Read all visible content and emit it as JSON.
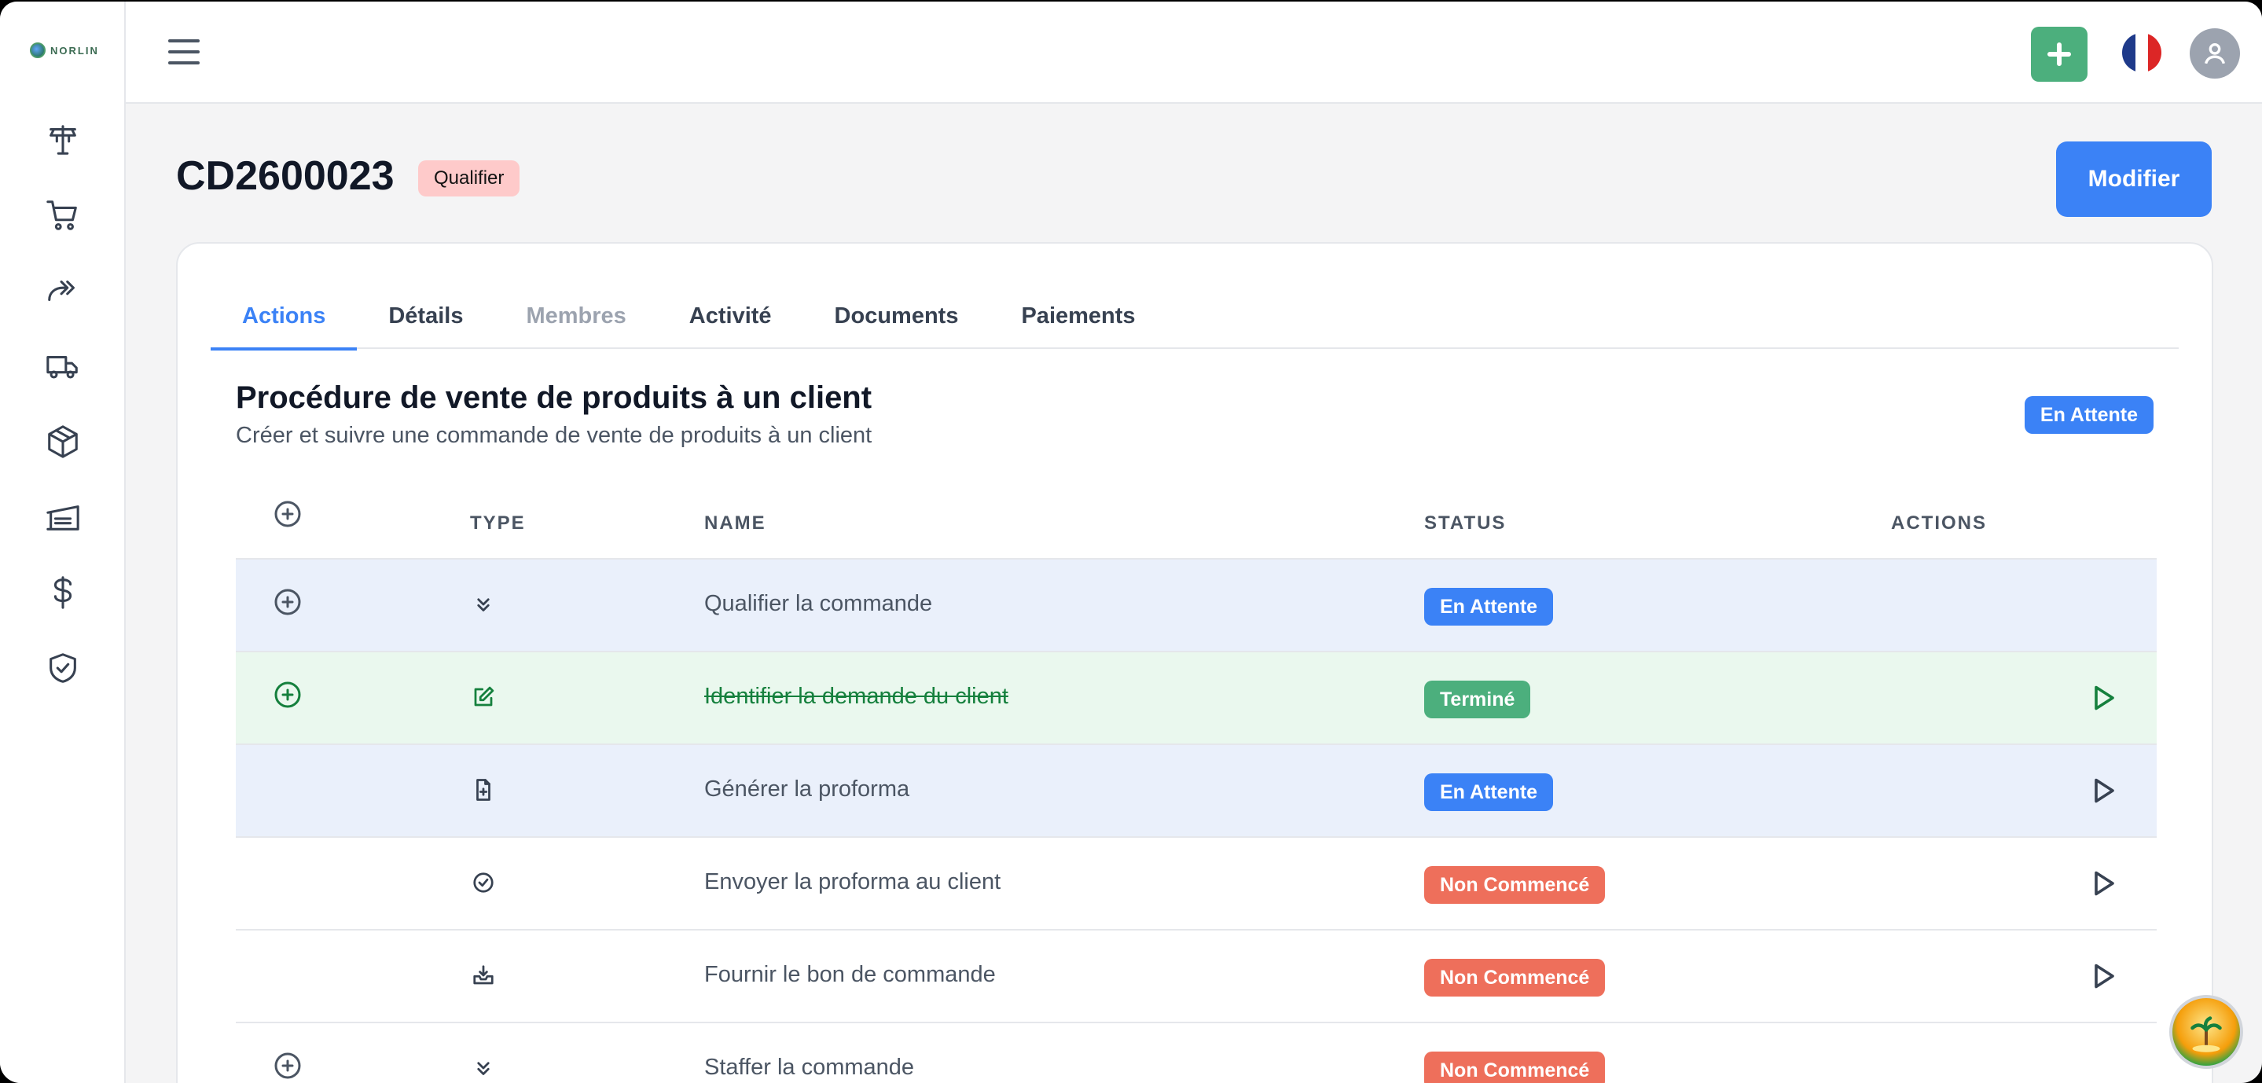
{
  "app": {
    "logo_text": "NORLIN"
  },
  "sidebar": {
    "items": [
      {
        "name": "dashboard"
      },
      {
        "name": "cart"
      },
      {
        "name": "forward"
      },
      {
        "name": "truck"
      },
      {
        "name": "package"
      },
      {
        "name": "warehouse"
      },
      {
        "name": "dollar"
      },
      {
        "name": "shield-check"
      }
    ]
  },
  "header": {
    "title": "CD2600023",
    "badge": "Qualifier",
    "modify_label": "Modifier"
  },
  "tabs": [
    {
      "label": "Actions",
      "state": "active"
    },
    {
      "label": "Détails",
      "state": "normal"
    },
    {
      "label": "Membres",
      "state": "muted"
    },
    {
      "label": "Activité",
      "state": "normal"
    },
    {
      "label": "Documents",
      "state": "normal"
    },
    {
      "label": "Paiements",
      "state": "normal"
    }
  ],
  "procedure": {
    "title": "Procédure de vente de produits à un client",
    "subtitle": "Créer et suivre une commande de vente de produits à un client",
    "status": "En Attente"
  },
  "table": {
    "headers": {
      "type": "TYPE",
      "name": "NAME",
      "status": "STATUS",
      "actions": "ACTIONS"
    },
    "rows": [
      {
        "type_icon": "chevrons-down-icon",
        "name": "Qualifier la commande",
        "status": "En Attente",
        "status_kind": "wait",
        "has_plus": true,
        "has_play": false,
        "tint": "blue"
      },
      {
        "type_icon": "edit-icon",
        "name": "Identifier la demande du client",
        "status": "Terminé",
        "status_kind": "done",
        "has_plus": true,
        "has_play": true,
        "tint": "green"
      },
      {
        "type_icon": "file-plus-icon",
        "name": "Générer la proforma",
        "status": "En Attente",
        "status_kind": "wait",
        "has_plus": false,
        "has_play": true,
        "tint": "blue"
      },
      {
        "type_icon": "check-circle-icon",
        "name": "Envoyer la proforma au client",
        "status": "Non Commencé",
        "status_kind": "none",
        "has_plus": false,
        "has_play": true,
        "tint": "none"
      },
      {
        "type_icon": "inbox-download-icon",
        "name": "Fournir le bon de commande",
        "status": "Non Commencé",
        "status_kind": "none",
        "has_plus": false,
        "has_play": true,
        "tint": "none"
      },
      {
        "type_icon": "chevrons-down-icon",
        "name": "Staffer la commande",
        "status": "Non Commencé",
        "status_kind": "none",
        "has_plus": true,
        "has_play": false,
        "tint": "none"
      }
    ]
  },
  "colors": {
    "primary": "#3b82f6",
    "success": "#4caf7d",
    "danger": "#ee6f5b",
    "badge_pink": "#fecaca"
  }
}
